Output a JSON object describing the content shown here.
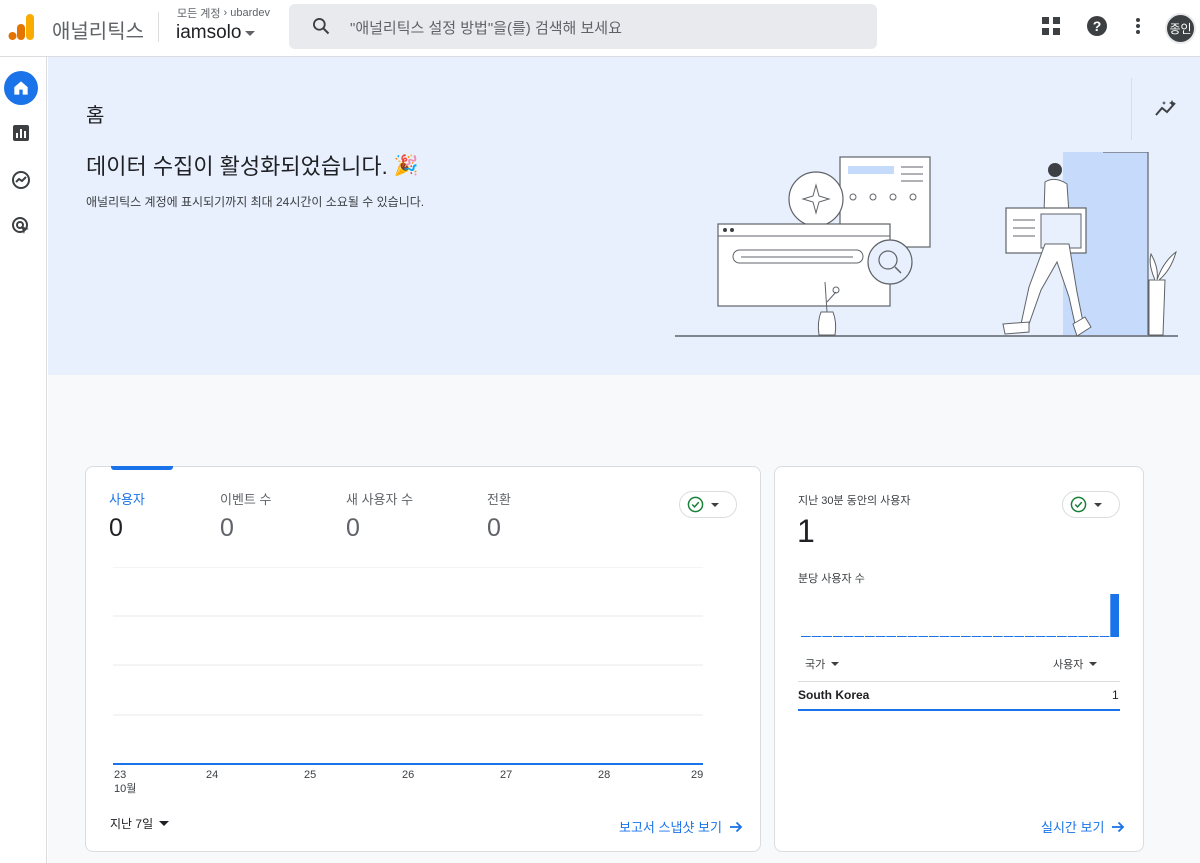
{
  "topbar": {
    "app_name": "애널리틱스",
    "breadcrumb_root": "모든 계정",
    "breadcrumb_account": "ubardev",
    "property": "iamsolo",
    "search_placeholder": "\"애널리틱스 설정 방법\"을(를) 검색해 보세요",
    "avatar_text": "종인"
  },
  "hero": {
    "page_title": "홈",
    "headline": "데이터 수집이 활성화되었습니다.",
    "headline_emoji": "🎉",
    "subtext": "애널리틱스 계정에 표시되기까지 최대 24시간이 소요될 수 있습니다."
  },
  "overview": {
    "metrics": [
      {
        "label": "사용자",
        "value": "0"
      },
      {
        "label": "이벤트 수",
        "value": "0"
      },
      {
        "label": "새 사용자 수",
        "value": "0"
      },
      {
        "label": "전환",
        "value": "0"
      }
    ],
    "x_ticks": [
      "23",
      "24",
      "25",
      "26",
      "27",
      "28",
      "29"
    ],
    "x_month": "10월",
    "period": "지난 7일",
    "link": "보고서 스냅샷 보기"
  },
  "realtime": {
    "label": "지난 30분 동안의 사용자",
    "value": "1",
    "per_minute_label": "분당 사용자 수",
    "col_country": "국가",
    "col_users": "사용자",
    "row_country": "South Korea",
    "row_users": "1",
    "link": "실시간 보기",
    "per_minute": [
      0,
      0,
      0,
      0,
      0,
      0,
      0,
      0,
      0,
      0,
      0,
      0,
      0,
      0,
      0,
      0,
      0,
      0,
      0,
      0,
      0,
      0,
      0,
      0,
      0,
      0,
      0,
      0,
      0,
      1
    ]
  },
  "colors": {
    "accent": "#1a73e8",
    "hero_bg": "#e8f0fe",
    "ok_green": "#188038"
  },
  "icons": [
    "analytics-logo-icon",
    "search-icon",
    "apps-grid-icon",
    "help-icon",
    "more-vert-icon",
    "home-icon",
    "reports-icon",
    "explore-icon",
    "advertising-icon",
    "insights-icon",
    "check-circle-icon",
    "arrow-right-icon"
  ]
}
